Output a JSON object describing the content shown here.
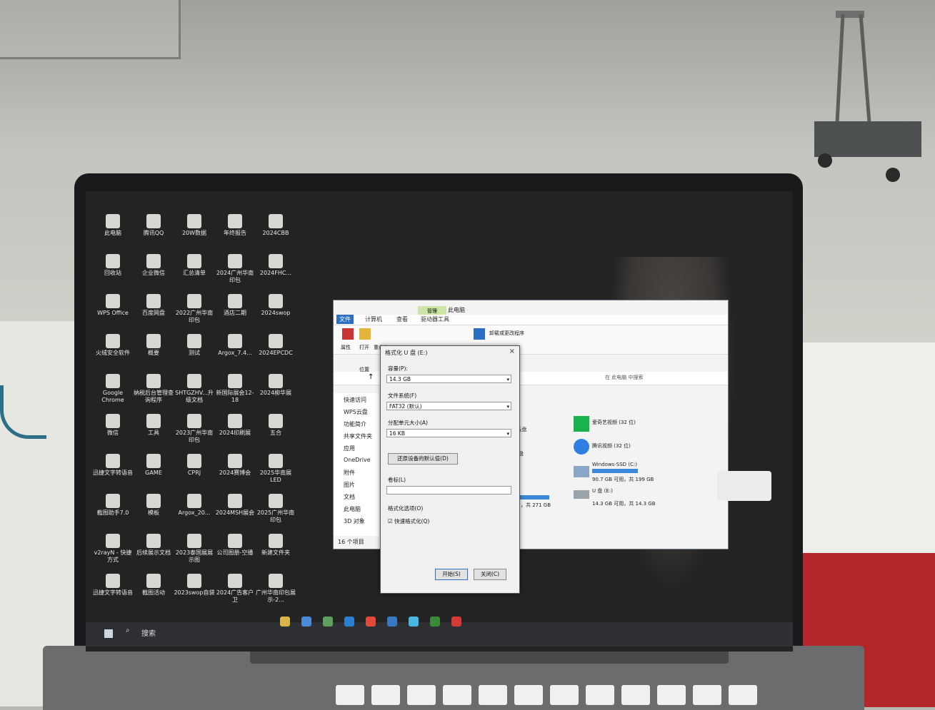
{
  "desktop_icons": [
    {
      "label": "此电脑"
    },
    {
      "label": "腾讯QQ"
    },
    {
      "label": "20W数据"
    },
    {
      "label": "年终报告"
    },
    {
      "label": "2024CBB"
    },
    {
      "label": "回收站"
    },
    {
      "label": "企业微信"
    },
    {
      "label": "汇总清单"
    },
    {
      "label": "2024广州华南印包"
    },
    {
      "label": "2024FHC..."
    },
    {
      "label": "WPS Office"
    },
    {
      "label": "百度网盘"
    },
    {
      "label": "2022广州华南印包"
    },
    {
      "label": "酒店二期"
    },
    {
      "label": "2024swop"
    },
    {
      "label": "火绒安全软件"
    },
    {
      "label": "概要"
    },
    {
      "label": "测试"
    },
    {
      "label": "Argox_7.4..."
    },
    {
      "label": "2024EPCDC"
    },
    {
      "label": "Google Chrome"
    },
    {
      "label": "纳税后台管理查询程序"
    },
    {
      "label": "SHTGZHV...升级文档"
    },
    {
      "label": "新国际展会12-18"
    },
    {
      "label": "2024柳华展"
    },
    {
      "label": "微信"
    },
    {
      "label": "工具"
    },
    {
      "label": "2023广州华南印包"
    },
    {
      "label": "2024印刷展"
    },
    {
      "label": "五合"
    },
    {
      "label": "迅捷文字转语音"
    },
    {
      "label": "GAME"
    },
    {
      "label": "CPRJ"
    },
    {
      "label": "2024赛博会"
    },
    {
      "label": "2025华南展LED"
    },
    {
      "label": "截图助手7.0"
    },
    {
      "label": "模板"
    },
    {
      "label": "Argox_20..."
    },
    {
      "label": "2024MSH展会"
    },
    {
      "label": "2025广州华南印包"
    },
    {
      "label": "v2rayN - 快捷方式"
    },
    {
      "label": "后续展示文档"
    },
    {
      "label": "2023泰国展展示图"
    },
    {
      "label": "公司图册-空播"
    },
    {
      "label": "新建文件夹"
    },
    {
      "label": "迅捷文字转语音"
    },
    {
      "label": "截图活动"
    },
    {
      "label": "2023swop自袋"
    },
    {
      "label": "2024广告客户卫"
    },
    {
      "label": "广州华南印包展示-2..."
    }
  ],
  "explorer": {
    "tabs": [
      "文件",
      "计算机",
      "查看",
      "驱动器工具"
    ],
    "manage_tab": "管理",
    "window_title": "此电脑",
    "toolbar": [
      "属性",
      "打开",
      "重命名"
    ],
    "toolbar_right": "卸载或更改程序",
    "location_label": "位置",
    "search_placeholder": "在 此电脑 中搜索",
    "nav_items": [
      "快速访问",
      "WPS云盘",
      "功能简介",
      "共享文件夹",
      "应用",
      "OneDrive",
      "附件",
      "图片",
      "文档",
      "此电脑",
      "3D 对象"
    ],
    "drives": [
      {
        "name": "爱奇艺视频 (32 位)"
      },
      {
        "name": "腾讯视频 (32 位)"
      },
      {
        "name": "Windows-SSD (C:)",
        "free": "90.7 GB 可用，共 199 GB"
      },
      {
        "name": "U 盘 (E:)",
        "free": "14.3 GB 可用，共 14.3 GB"
      }
    ],
    "left_fragments": [
      "S云盘",
      "网盘"
    ],
    "bar_text": "，共 271 GB",
    "status": "16 个项目"
  },
  "format_dialog": {
    "title": "格式化 U 盘 (E:)",
    "capacity_label": "容量(P):",
    "capacity_value": "14.3 GB",
    "fs_label": "文件系统(F)",
    "fs_value": "FAT32 (默认)",
    "unit_label": "分配单元大小(A)",
    "unit_value": "16 KB",
    "restore_button": "还原设备的默认值(D)",
    "volume_label": "卷标(L)",
    "volume_value": "",
    "options_label": "格式化选项(O)",
    "quick_format": "快速格式化(Q)",
    "start_button": "开始(S)",
    "close_button": "关闭(C)"
  },
  "taskbar": {
    "search": "搜索"
  },
  "colors": {
    "accent": "#3a88d6",
    "manage_tab": "#cde6a8"
  }
}
